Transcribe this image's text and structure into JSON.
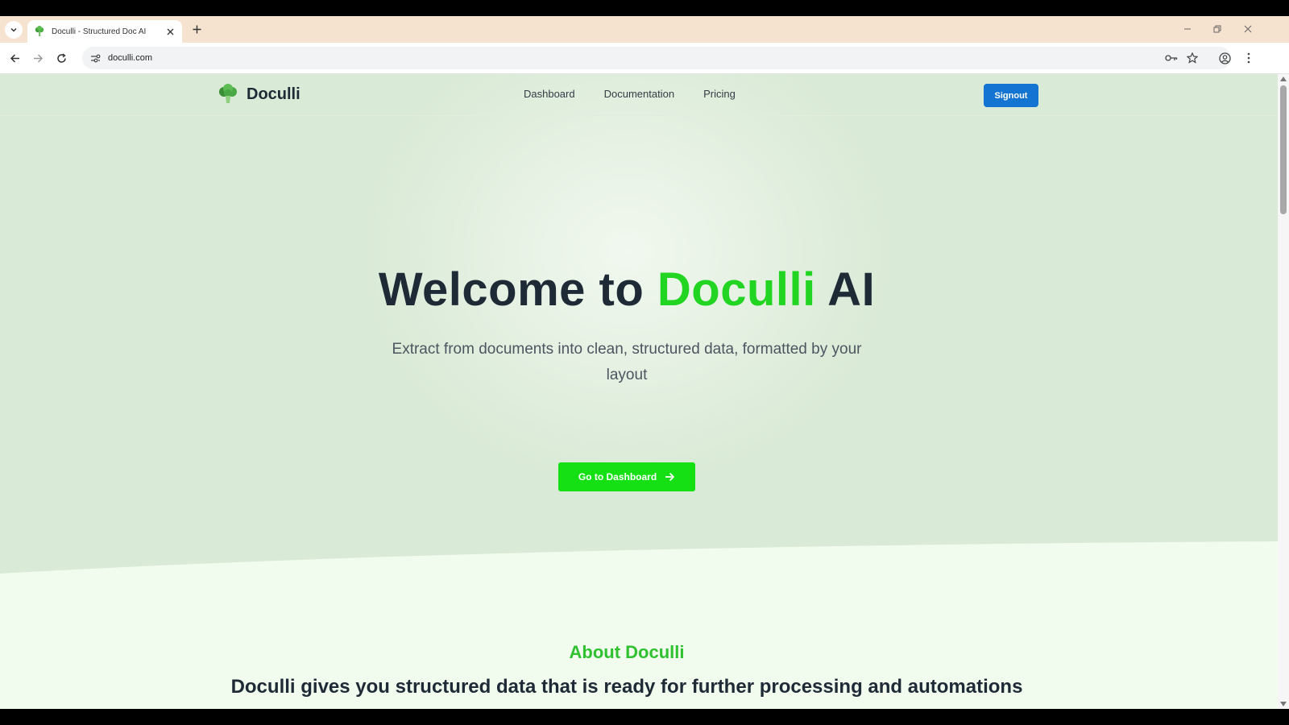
{
  "browser": {
    "tab_title": "Doculli - Structured Doc AI",
    "url": "doculli.com"
  },
  "site": {
    "brand": "Doculli",
    "nav": [
      "Dashboard",
      "Documentation",
      "Pricing"
    ],
    "signout_label": "Signout"
  },
  "hero": {
    "title_prefix": "Welcome to ",
    "title_highlight": "Doculli",
    "title_suffix": " AI",
    "subtitle": "Extract from documents into clean, structured data, formatted by your layout",
    "cta_label": "Go to Dashboard"
  },
  "about": {
    "heading": "About Doculli",
    "text": "Doculli gives you structured data that is ready for further processing and automations"
  },
  "colors": {
    "accent_green": "#22d522",
    "signout_blue": "#1374d1",
    "cta_green": "#14e014"
  }
}
